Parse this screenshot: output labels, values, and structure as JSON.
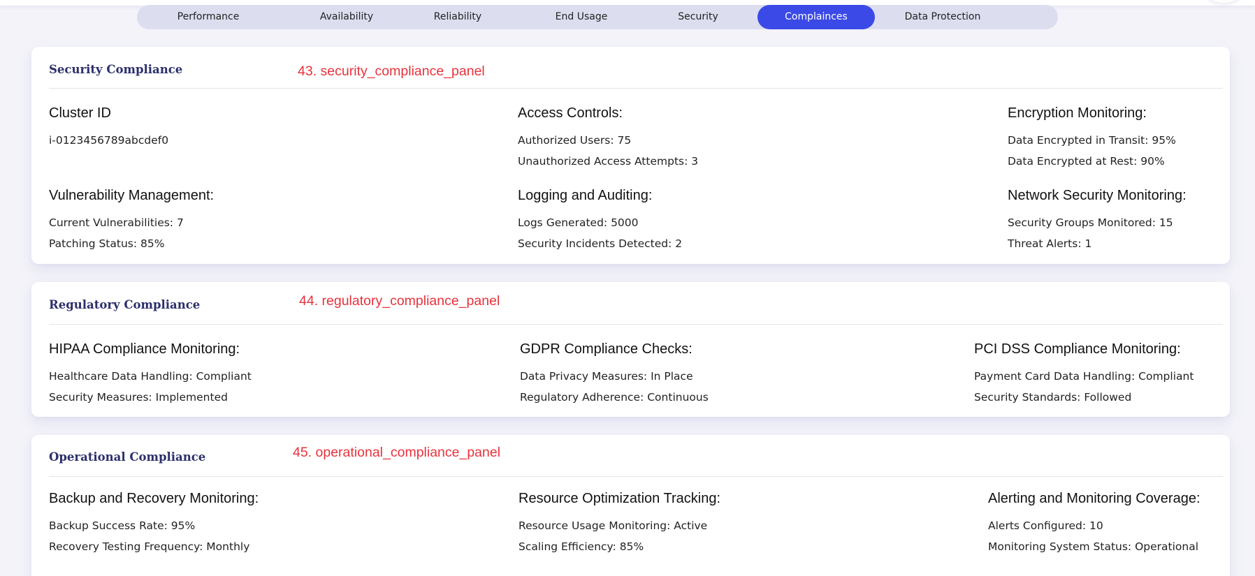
{
  "tabs": [
    {
      "label": "Performance"
    },
    {
      "label": "Availability"
    },
    {
      "label": "Reliability"
    },
    {
      "label": "End Usage"
    },
    {
      "label": "Security"
    },
    {
      "label": "Complainces",
      "active": true
    },
    {
      "label": "Data Protection"
    }
  ],
  "accent_color": "#3b4ae6",
  "annotation_color": "#e8323c",
  "panels": [
    {
      "title": "Security Compliance",
      "annotation": "43. security_compliance_panel",
      "blocks": [
        {
          "heading": "Cluster ID",
          "lines": [
            "i-0123456789abcdef0"
          ]
        },
        {
          "heading": "Access Controls:",
          "lines": [
            "Authorized Users: 75",
            "Unauthorized Access Attempts: 3"
          ]
        },
        {
          "heading": "Encryption Monitoring:",
          "lines": [
            "Data Encrypted in Transit: 95%",
            "Data Encrypted at Rest: 90%"
          ]
        },
        {
          "heading": "Vulnerability Management:",
          "lines": [
            "Current Vulnerabilities: 7",
            "Patching Status: 85%"
          ]
        },
        {
          "heading": "Logging and Auditing:",
          "lines": [
            "Logs Generated: 5000",
            "Security Incidents Detected: 2"
          ]
        },
        {
          "heading": "Network Security Monitoring:",
          "lines": [
            "Security Groups Monitored: 15",
            "Threat Alerts: 1"
          ]
        }
      ]
    },
    {
      "title": "Regulatory Compliance",
      "annotation": "44. regulatory_compliance_panel",
      "blocks": [
        {
          "heading": "HIPAA Compliance Monitoring:",
          "lines": [
            "Healthcare Data Handling: Compliant",
            "Security Measures: Implemented"
          ]
        },
        {
          "heading": "GDPR Compliance Checks:",
          "lines": [
            "Data Privacy Measures: In Place",
            "Regulatory Adherence: Continuous"
          ]
        },
        {
          "heading": "PCI DSS Compliance Monitoring:",
          "lines": [
            "Payment Card Data Handling: Compliant",
            "Security Standards: Followed"
          ]
        }
      ]
    },
    {
      "title": "Operational Compliance",
      "annotation": "45. operational_compliance_panel",
      "blocks": [
        {
          "heading": "Backup and Recovery Monitoring:",
          "lines": [
            "Backup Success Rate: 95%",
            "Recovery Testing Frequency: Monthly"
          ]
        },
        {
          "heading": "Resource Optimization Tracking:",
          "lines": [
            "Resource Usage Monitoring: Active",
            "Scaling Efficiency: 85%"
          ]
        },
        {
          "heading": "Alerting and Monitoring Coverage:",
          "lines": [
            "Alerts Configured: 10",
            "Monitoring System Status: Operational"
          ]
        }
      ]
    }
  ]
}
